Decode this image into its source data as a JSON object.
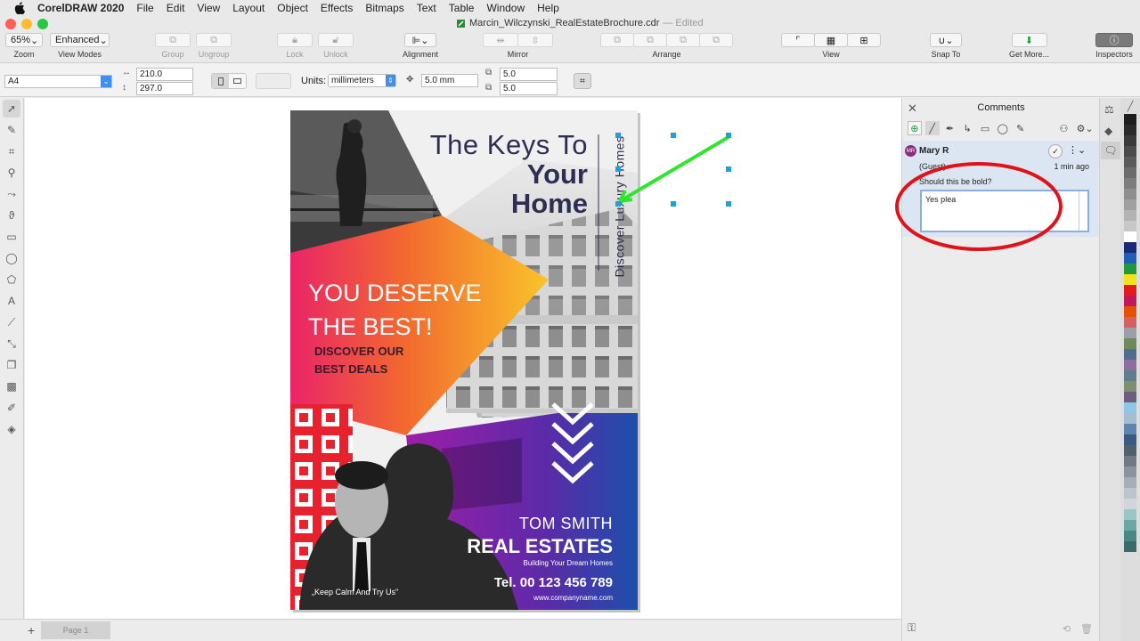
{
  "menubar": {
    "app_name": "CorelDRAW 2020",
    "items": [
      "File",
      "Edit",
      "View",
      "Layout",
      "Object",
      "Effects",
      "Bitmaps",
      "Text",
      "Table",
      "Window",
      "Help"
    ]
  },
  "window": {
    "title": "Marcin_Wilczynski_RealEstateBrochure.cdr",
    "edited": "— Edited"
  },
  "toolbar": {
    "zoom_value": "65%",
    "zoom_label": "Zoom",
    "viewmode_value": "Enhanced",
    "viewmode_label": "View Modes",
    "group_label": "Group",
    "ungroup_label": "Ungroup",
    "lock_label": "Lock",
    "unlock_label": "Unlock",
    "alignment_label": "Alignment",
    "mirror_label": "Mirror",
    "arrange_label": "Arrange",
    "view_label": "View",
    "snapto_label": "Snap To",
    "getmore_label": "Get More...",
    "inspectors_label": "Inspectors"
  },
  "propbar": {
    "page_size": "A4",
    "width": "210.0",
    "height": "297.0",
    "units_label": "Units:",
    "units_value": "millimeters",
    "nudge": "5.0 mm",
    "dup_x": "5.0",
    "dup_y": "5.0"
  },
  "brochure": {
    "headline_1": "The Keys To",
    "headline_2": "Your",
    "headline_3": "Home",
    "vertical_text": "Discover Luxury Homes",
    "deserve_1": "YOU DESERVE",
    "deserve_2": "THE BEST!",
    "discover_1": "DISCOVER OUR",
    "discover_2": "BEST DEALS",
    "agent_name": "TOM SMITH",
    "company": "REAL ESTATES",
    "tagline": "Building Your Dream Homes",
    "phone": "Tel. 00 123 456 789",
    "website": "www.companyname.com",
    "quote": "„Keep Calm And Try Us\""
  },
  "status": {
    "page_tab": "Page 1"
  },
  "comments": {
    "title": "Comments",
    "author_initials": "MR",
    "author": "Mary R",
    "role": "(Guest)",
    "time": "1 min ago",
    "comment_text": "Should this be bold?",
    "reply_text": "Yes plea"
  },
  "palette_colors": [
    "#1d1d1d",
    "#2a2a2a",
    "#3a3a3a",
    "#4b4b4b",
    "#5b5b5b",
    "#6c6c6c",
    "#7d7d7d",
    "#8e8e8e",
    "#a0a0a0",
    "#b3b3b3",
    "#c7c7c7",
    "#ffffff",
    "#1b2a78",
    "#1f5fb5",
    "#1e9a3a",
    "#f2e21a",
    "#e41a1c",
    "#c2185b",
    "#e65100",
    "#d46060",
    "#9aa0a6",
    "#6f8a5a",
    "#4e6e8e",
    "#8e6e9e",
    "#5e7e8e",
    "#7e8e6e",
    "#6e5e7e",
    "#8ec7e6",
    "#a6bcd0",
    "#5b86b0",
    "#3a5a80",
    "#506070",
    "#707a84",
    "#8a949e",
    "#a4aeb8",
    "#bcc4cc",
    "#d0d6dc",
    "#9cc5c5",
    "#6aa8a8",
    "#4a8888",
    "#3a6a6a"
  ],
  "colors": {
    "accent": "#1da1dd",
    "highlight_circle": "#e0121a",
    "arrow": "#2ee62e",
    "headline": "#2e2e52",
    "orange": "#f7931e",
    "pink": "#e8225c",
    "purple": "#7a1fa2",
    "blue": "#1f4aa8"
  }
}
